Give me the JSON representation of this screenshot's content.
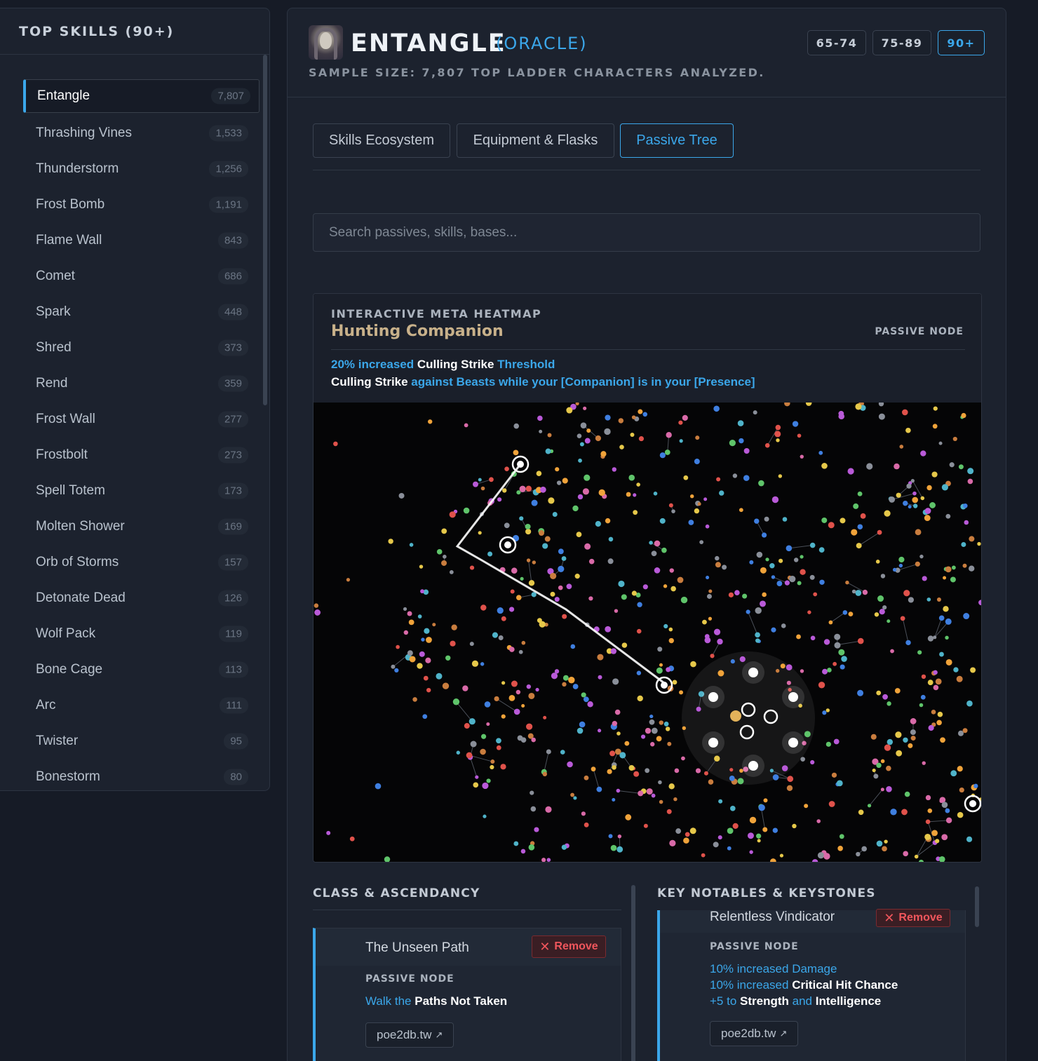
{
  "sidebar": {
    "title": "TOP SKILLS (90+)",
    "items": [
      {
        "label": "Entangle",
        "count": "7,807"
      },
      {
        "label": "Thrashing Vines",
        "count": "1,533"
      },
      {
        "label": "Thunderstorm",
        "count": "1,256"
      },
      {
        "label": "Frost Bomb",
        "count": "1,191"
      },
      {
        "label": "Flame Wall",
        "count": "843"
      },
      {
        "label": "Comet",
        "count": "686"
      },
      {
        "label": "Spark",
        "count": "448"
      },
      {
        "label": "Shred",
        "count": "373"
      },
      {
        "label": "Rend",
        "count": "359"
      },
      {
        "label": "Frost Wall",
        "count": "277"
      },
      {
        "label": "Frostbolt",
        "count": "273"
      },
      {
        "label": "Spell Totem",
        "count": "173"
      },
      {
        "label": "Molten Shower",
        "count": "169"
      },
      {
        "label": "Orb of Storms",
        "count": "157"
      },
      {
        "label": "Detonate Dead",
        "count": "126"
      },
      {
        "label": "Wolf Pack",
        "count": "119"
      },
      {
        "label": "Bone Cage",
        "count": "113"
      },
      {
        "label": "Arc",
        "count": "111"
      },
      {
        "label": "Twister",
        "count": "95"
      },
      {
        "label": "Bonestorm",
        "count": "80"
      }
    ]
  },
  "header": {
    "skill": "ENTANGLE",
    "class": "(ORACLE)",
    "sample": "SAMPLE SIZE: 7,807 TOP LADDER CHARACTERS ANALYZED.",
    "levels": [
      "65-74",
      "75-89",
      "90+"
    ]
  },
  "tabs": [
    "Skills Ecosystem",
    "Equipment & Flasks",
    "Passive Tree"
  ],
  "search": {
    "placeholder": "Search passives, skills, bases..."
  },
  "heatmap": {
    "kicker": "INTERACTIVE META HEATMAP",
    "node_title": "Hunting Companion",
    "node_type": "PASSIVE NODE",
    "mod1": {
      "a": "20% increased",
      "b": " Culling Strike ",
      "c": "Threshold"
    },
    "mod2": {
      "a": "Culling Strike ",
      "b": "against Beasts while your [Companion] is in your [Presence]"
    }
  },
  "class_section": {
    "title": "CLASS & ASCENDANCY",
    "card": {
      "name": "The Unseen Path",
      "remove": "Remove",
      "type": "PASSIVE NODE",
      "mod": {
        "a": "Walk the ",
        "b": "Paths Not Taken"
      },
      "link": "poe2db.tw"
    }
  },
  "notables_section": {
    "title": "KEY NOTABLES & KEYSTONES",
    "card": {
      "name": "Relentless Vindicator",
      "remove": "Remove",
      "type": "PASSIVE NODE",
      "mods": [
        {
          "a": "10% increased ",
          "b": "Damage"
        },
        {
          "a": "10% increased ",
          "b": "Critical Hit Chance"
        },
        {
          "a": "+5 to ",
          "b": "Strength",
          "c": " and ",
          "d": "Intelligence"
        }
      ],
      "link": "poe2db.tw"
    }
  },
  "colors": {
    "accent": "#3ba7ea",
    "gold": "#c8b18a",
    "danger": "#f0565c"
  }
}
